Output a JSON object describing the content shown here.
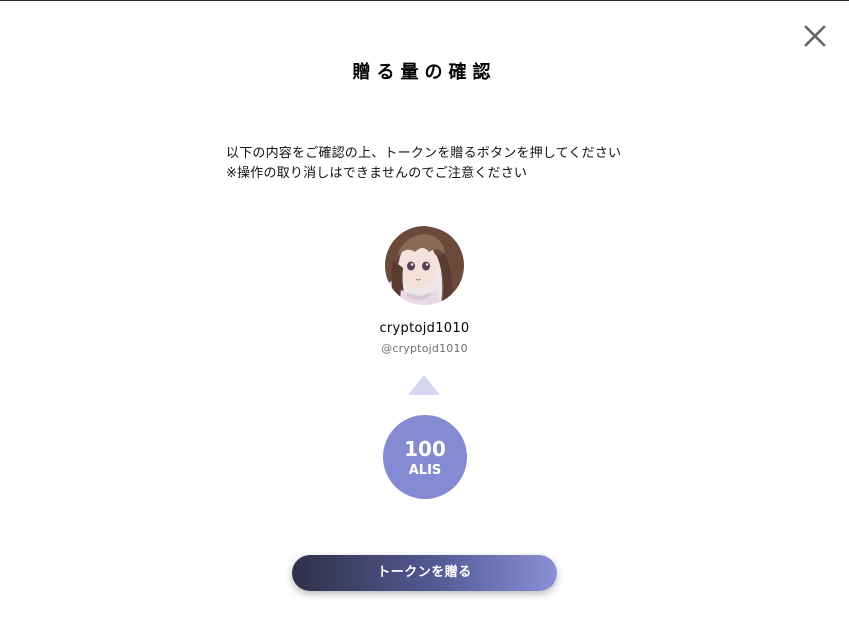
{
  "dialog": {
    "title": "贈る量の確認",
    "description": "以下の内容をご確認の上、トークンを贈るボタンを押してください ※操作の取り消しはできませんのでご注意ください"
  },
  "recipient": {
    "display_name": "cryptojd1010",
    "user_id": "@cryptojd1010"
  },
  "amount": {
    "value": "100",
    "unit": "ALIS"
  },
  "actions": {
    "send_label": "トークンを贈る"
  },
  "icons": {
    "close": "close-icon",
    "arrow": "triangle-up-icon"
  },
  "colors": {
    "amount_circle": "#858bd2",
    "arrow": "#d5d7f0",
    "button_start": "#2f3048",
    "button_end": "#8a90d6"
  }
}
